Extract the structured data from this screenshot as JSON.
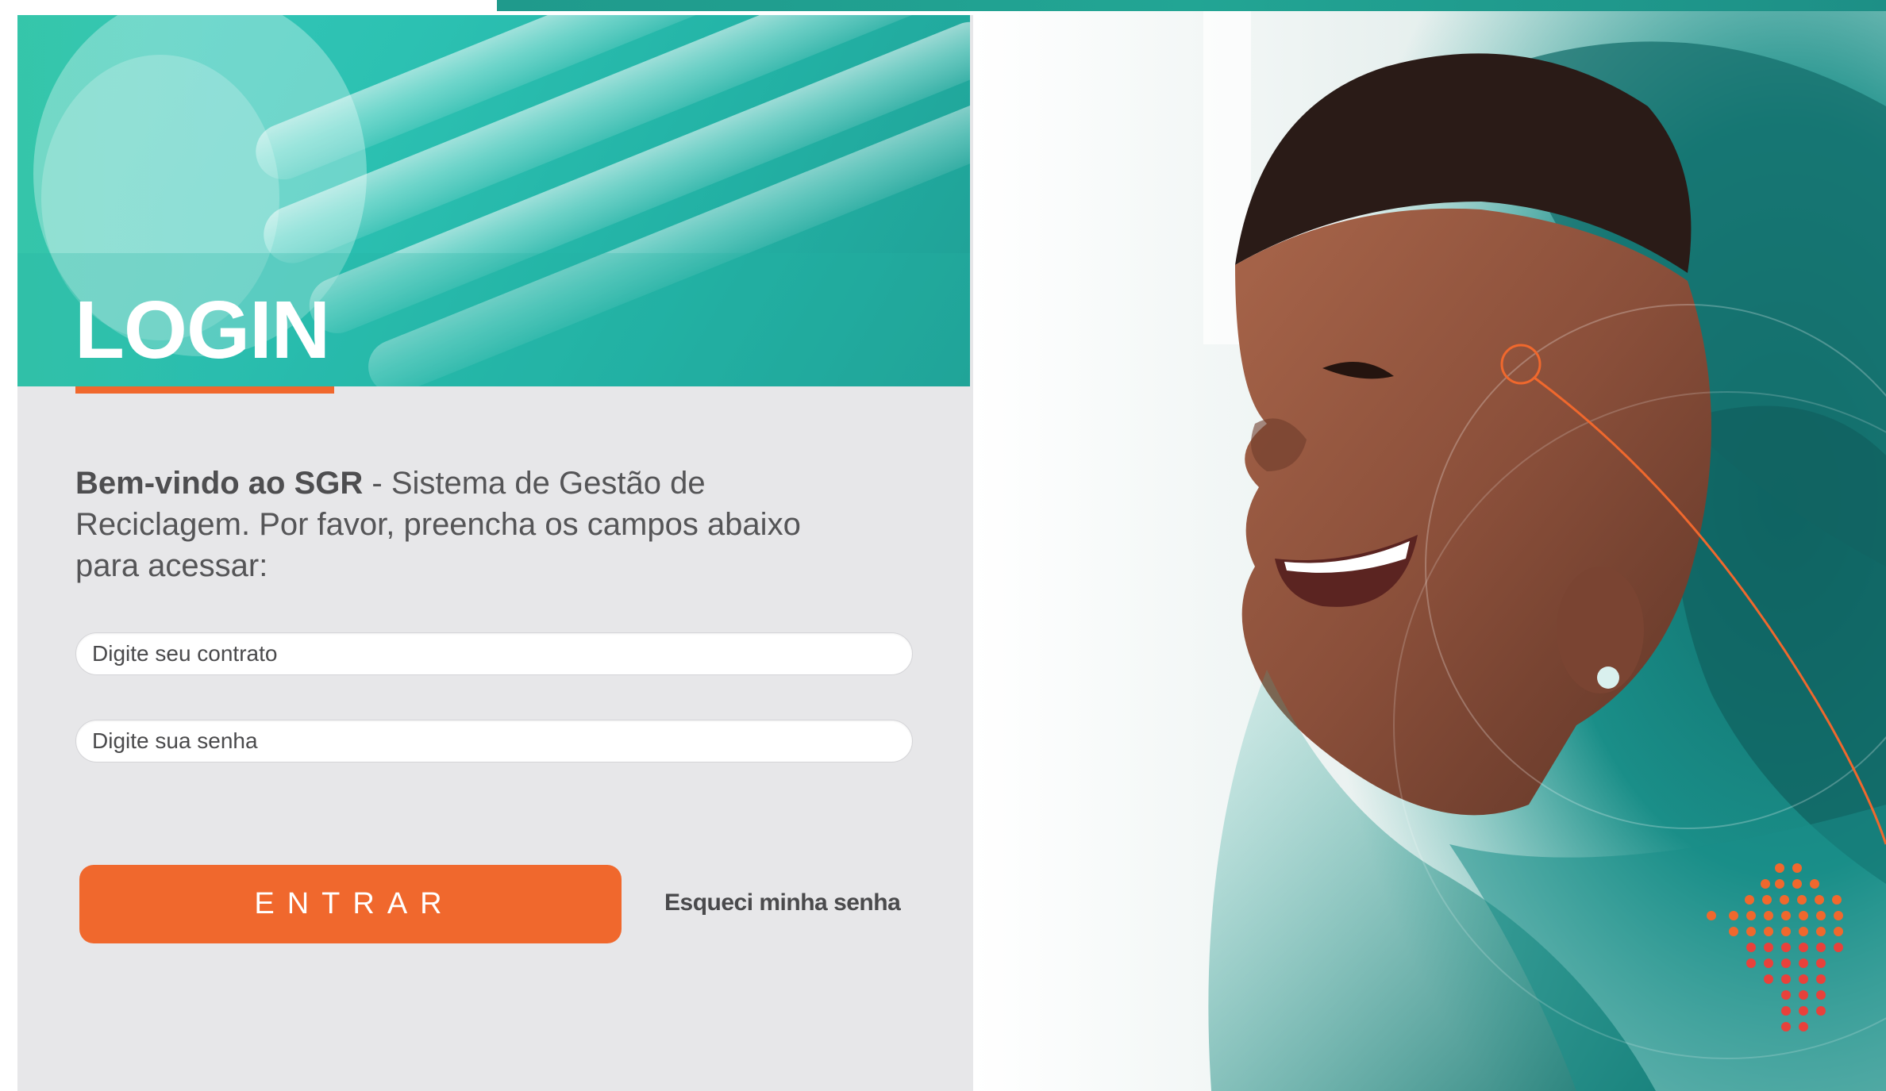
{
  "login": {
    "title": "LOGIN",
    "welcome_bold": "Bem-vindo ao SGR",
    "welcome_rest": " - Sistema de Gestão de Reciclagem. Por favor, preencha os campos abaixo para acessar:",
    "contract_placeholder": "Digite seu contrato",
    "password_placeholder": "Digite sua senha",
    "submit_label": "ENTRAR",
    "forgot_label": "Esqueci minha senha"
  },
  "icons": {
    "hero_image": "fluorescent-lamp-photo",
    "side_image": "smiling-woman-photo",
    "brand_mark": "dotted-logo-icon"
  },
  "colors": {
    "accent": "#f0682d",
    "teal": "#23b3a6",
    "panel": "#e7e7e9"
  }
}
